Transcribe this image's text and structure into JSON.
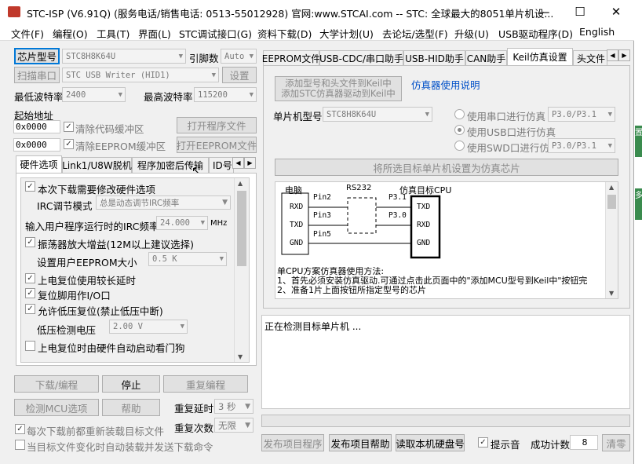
{
  "title": "STC-ISP (V6.91Q) (服务电话/销售电话: 0513-55012928) 官网:www.STCAI.com  -- STC: 全球最大的8051单片机设...",
  "window_controls": {
    "min": "—",
    "max": "☐",
    "close": "✕"
  },
  "menu": [
    "文件(F)",
    "编程(O)",
    "工具(T)",
    "界面(L)",
    "STC调试接口(G)",
    "资料下载(D)",
    "大学计划(U)",
    "去论坛/选型(F)",
    "升级(U)",
    "USB驱动程序(D)",
    "English"
  ],
  "left": {
    "chip_btn": "芯片型号",
    "chip_value": "STC8H8K64U",
    "pin_label": "引脚数",
    "pin_value": "Auto",
    "scan_btn": "扫描串口",
    "port_value": "STC USB Writer (HID1)",
    "settings_btn": "设置",
    "min_baud_label": "最低波特率",
    "min_baud_value": "2400",
    "max_baud_label": "最高波特率",
    "max_baud_value": "115200",
    "start_addr_label": "起始地址",
    "addr1": "0x0000",
    "clear_code": "清除代码缓冲区",
    "open_prog": "打开程序文件",
    "addr2": "0x0000",
    "clear_eeprom": "清除EEPROM缓冲区",
    "open_eeprom": "打开EEPROM文件",
    "tabs": [
      "硬件选项",
      "Link1/U8W脱机",
      "程序加密后传输",
      "ID号"
    ],
    "hw": {
      "opt1": "本次下载需要修改硬件选项",
      "irc_mode_label": "IRC调节模式",
      "irc_mode_value": "总是动态调节IRC频率",
      "input_freq_label": "输入用户程序运行时的IRC频率",
      "input_freq_value": "24.000",
      "input_freq_unit": "MHz",
      "opt2": "振荡器放大增益(12M以上建议选择)",
      "eeprom_size_label": "设置用户EEPROM大小",
      "eeprom_size_value": "0.5 K",
      "opt3": "上电复位使用较长延时",
      "opt4": "复位脚用作I/O口",
      "opt5": "允许低压复位(禁止低压中断)",
      "lvd_label": "低压检测电压",
      "lvd_value": "2.00 V",
      "opt6": "上电复位时由硬件自动启动看门狗"
    },
    "download_btn": "下载/编程",
    "stop_btn": "停止",
    "reprog_btn": "重复编程",
    "detect_btn": "检测MCU选项",
    "help_btn": "帮助",
    "repeat_delay_label": "重复延时",
    "repeat_delay_value": "3 秒",
    "repeat_count_label": "重复次数",
    "repeat_count_value": "无限",
    "reload_check": "每次下载前都重新装载目标文件",
    "auto_check": "当目标文件变化时自动装载并发送下载命令"
  },
  "right": {
    "tabs": [
      "EEPROM文件",
      "USB-CDC/串口助手",
      "USB-HID助手",
      "CAN助手",
      "Keil仿真设置",
      "头文件"
    ],
    "add_keil_btn_l1": "添加型号和头文件到Keil中",
    "add_keil_btn_l2": "添加STC仿真器驱动到Keil中",
    "sim_help_link": "仿真器使用说明",
    "mcu_label": "单片机型号",
    "mcu_value": "STC8H8K64U",
    "radio_serial": "使用串口进行仿真",
    "radio_usb": "使用USB口进行仿真",
    "radio_swd": "使用SWD口进行仿真",
    "serial_value": "P3.0/P3.1",
    "swd_value": "P3.0/P3.1",
    "set_sim_btn": "将所选目标单片机设置为仿真芯片",
    "diagram": {
      "pc": "电脑",
      "rs232": "RS232",
      "target": "仿真目标CPU",
      "rxd": "RXD",
      "txd": "TXD",
      "gnd": "GND",
      "pin2": "Pin2",
      "pin3": "Pin3",
      "pin5": "Pin5",
      "p31": "P3.1",
      "p30": "P3.0",
      "ttxd": "TXD",
      "trxd": "RXD",
      "tgnd": "GND"
    },
    "method_l1": "单CPU方案仿真器使用方法:",
    "method_l2": "1、首先必须安装仿真驱动.可通过点击此页面中的\"添加MCU型号到Keil中\"按钮完",
    "method_l3": "2、准备1片上面按钮所指定型号的芯片",
    "log_text": "正在检测目标单片机 ...",
    "publish_btn": "发布项目程序",
    "publish_help_btn": "发布项目帮助",
    "read_disk_btn": "读取本机硬盘号",
    "sound_check": "提示音",
    "success_label": "成功计数",
    "success_value": "8",
    "clear_btn": "清零"
  },
  "side_edge": [
    "置",
    "多"
  ]
}
